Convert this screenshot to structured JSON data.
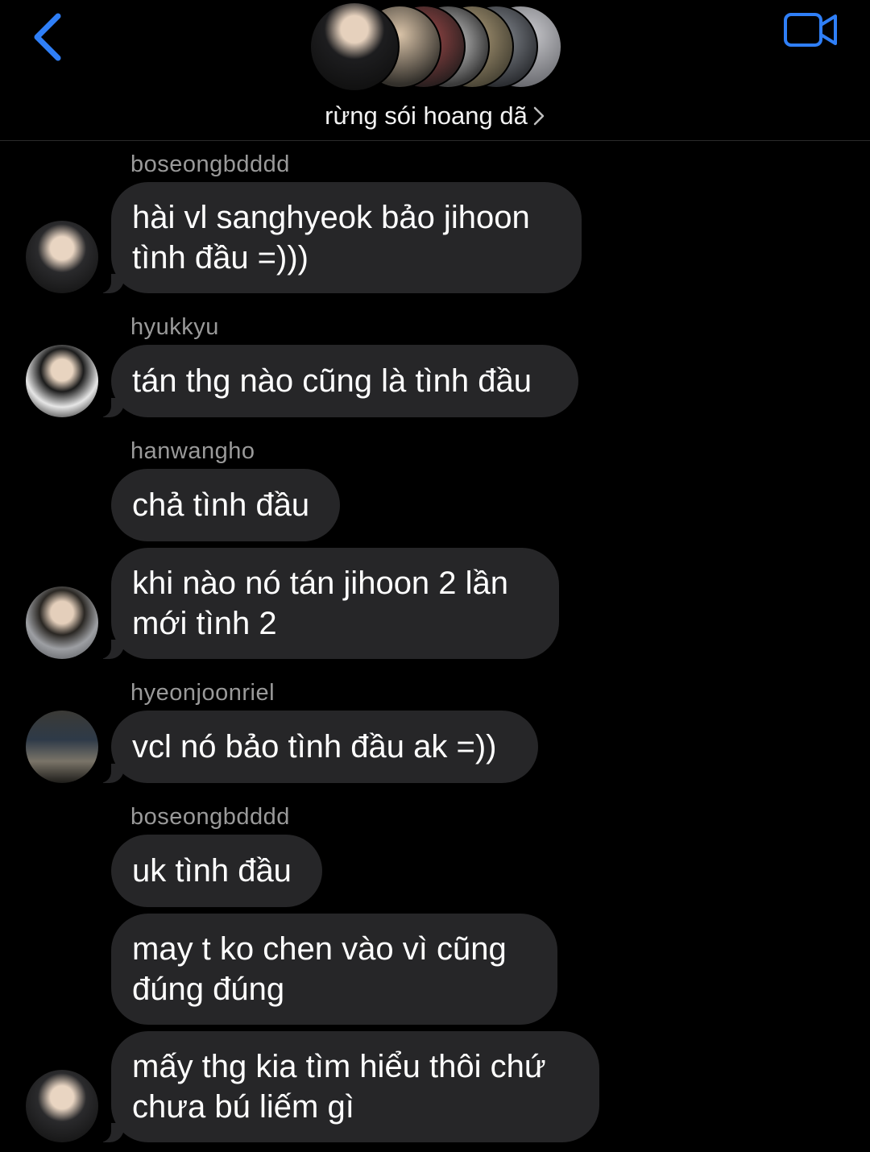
{
  "header": {
    "group_name": "rừng sói hoang dã",
    "back_icon": "chevron-left-icon",
    "video_icon": "video-camera-icon",
    "accent_color": "#2f7ff7"
  },
  "messages": [
    {
      "sender": "boseongbdddd",
      "text": "hài vl sanghyeok bảo jihoon\ntình đầu =)))"
    },
    {
      "sender": "hyukkyu",
      "text": "tán thg nào cũng là tình đầu"
    },
    {
      "sender": "hanwangho",
      "text": "chả tình đầu"
    },
    {
      "sender": "",
      "text": "khi nào nó tán jihoon 2 lần\nmới tình 2"
    },
    {
      "sender": "hyeonjoonriel",
      "text": "vcl nó bảo tình đầu ak =))"
    },
    {
      "sender": "boseongbdddd",
      "text": "uk tình đầu"
    },
    {
      "sender": "",
      "text": "may t ko chen vào vì cũng\nđúng đúng"
    },
    {
      "sender": "",
      "text": "mấy thg kia tìm hiểu thôi chứ\nchưa bú liếm gì"
    }
  ]
}
